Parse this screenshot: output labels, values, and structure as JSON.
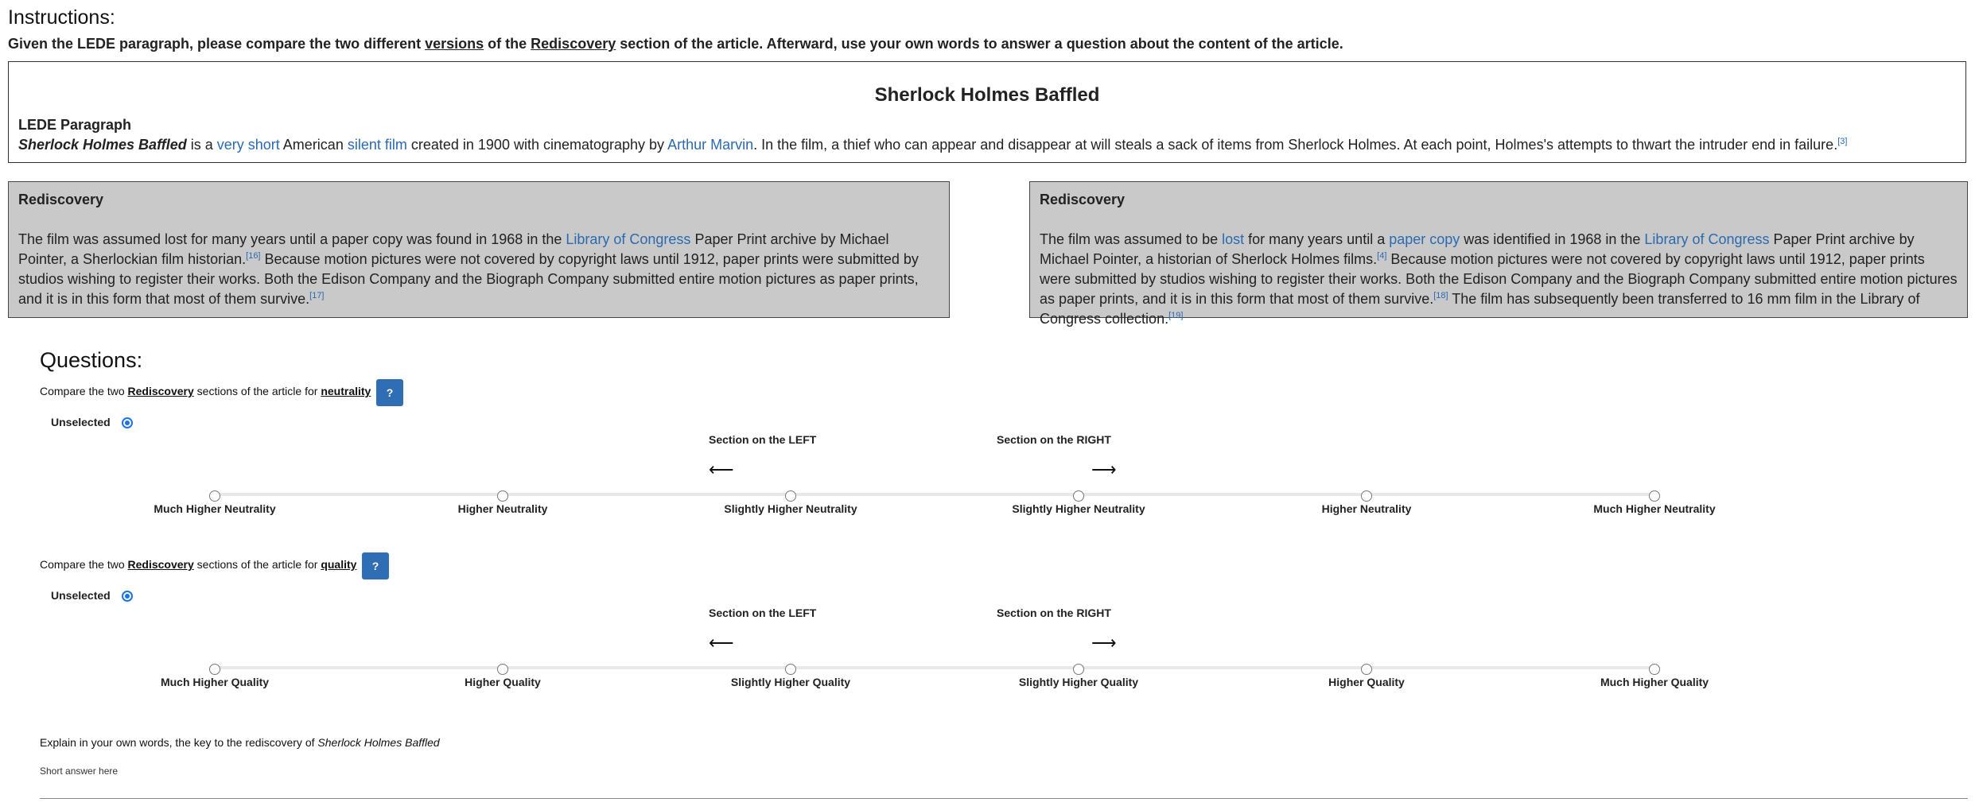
{
  "instructions": {
    "title": "Instructions:",
    "text_1": "Given the LEDE paragraph, please compare the two different ",
    "versions": "versions",
    "text_2": " of the ",
    "rediscovery": "Rediscovery",
    "text_3": " section of the article. Afterward, use your own words to answer a question about the content of the article."
  },
  "lede": {
    "article_title": "Sherlock Holmes Baffled",
    "label": "LEDE Paragraph",
    "title_em": "Sherlock Holmes Baffled",
    "t1": " is a ",
    "link_very_short": "very short",
    "t2": " American ",
    "link_silent_film": "silent film",
    "t3": " created in 1900 with cinematography by ",
    "link_arthur_marvin": "Arthur Marvin",
    "t4": ". In the film, a thief who can appear and disappear at will steals a sack of items from Sherlock Holmes. At each point, Holmes's attempts to thwart the intruder end in failure.",
    "ref": "[3]"
  },
  "left_section": {
    "heading": "Rediscovery",
    "t1": "The film was assumed lost for many years until a paper copy was found in 1968 in the ",
    "link_loc": "Library of Congress",
    "t2": " Paper Print archive by Michael Pointer, a Sherlockian film historian.",
    "ref1": "[16]",
    "t3": " Because motion pictures were not covered by copyright laws until 1912, paper prints were submitted by studios wishing to register their works. Both the Edison Company and the Biograph Company submitted entire motion pictures as paper prints, and it is in this form that most of them survive.",
    "ref2": "[17]"
  },
  "right_section": {
    "heading": "Rediscovery",
    "t1": "The film was assumed to be ",
    "link_lost": "lost",
    "t2": " for many years until a ",
    "link_paper_copy": "paper copy",
    "t3": " was identified in 1968 in the ",
    "link_loc": "Library of Congress",
    "t4": " Paper Print archive by Michael Pointer, a historian of Sherlock Holmes films.",
    "ref1": "[4]",
    "t5": " Because motion pictures were not covered by copyright laws until 1912, paper prints were submitted by studios wishing to register their works. Both the Edison Company and the Biograph Company submitted entire motion pictures as paper prints, and it is in this form that most of them survive.",
    "ref2": "[18]",
    "t6": " The film has subsequently been transferred to 16 mm film in the Library of Congress collection.",
    "ref3": "[19]"
  },
  "questions": {
    "title": "Questions:",
    "q1": {
      "prefix": "Compare the two ",
      "section": "Rediscovery",
      "middle": " sections of the article for ",
      "criterion": "neutrality",
      "help": "?",
      "unselected": "Unselected",
      "left_label": "Section on the LEFT",
      "right_label": "Section on the RIGHT",
      "left_arrow": "⟵",
      "right_arrow": "⟶",
      "options": [
        "Much Higher Neutrality",
        "Higher Neutrality",
        "Slightly Higher Neutrality",
        "Slightly Higher Neutrality",
        "Higher Neutrality",
        "Much Higher Neutrality"
      ]
    },
    "q2": {
      "prefix": "Compare the two ",
      "section": "Rediscovery",
      "middle": " sections of the article for ",
      "criterion": "quality",
      "help": "?",
      "unselected": "Unselected",
      "left_label": "Section on the LEFT",
      "right_label": "Section on the RIGHT",
      "left_arrow": "⟵",
      "right_arrow": "⟶",
      "options": [
        "Much Higher Quality",
        "Higher Quality",
        "Slightly Higher Quality",
        "Slightly Higher Quality",
        "Higher Quality",
        "Much Higher Quality"
      ]
    },
    "explain": {
      "prefix": "Explain in your own words, the key to the rediscovery of ",
      "title_em": "Sherlock Holmes Baffled",
      "placeholder": "Short answer here"
    }
  }
}
